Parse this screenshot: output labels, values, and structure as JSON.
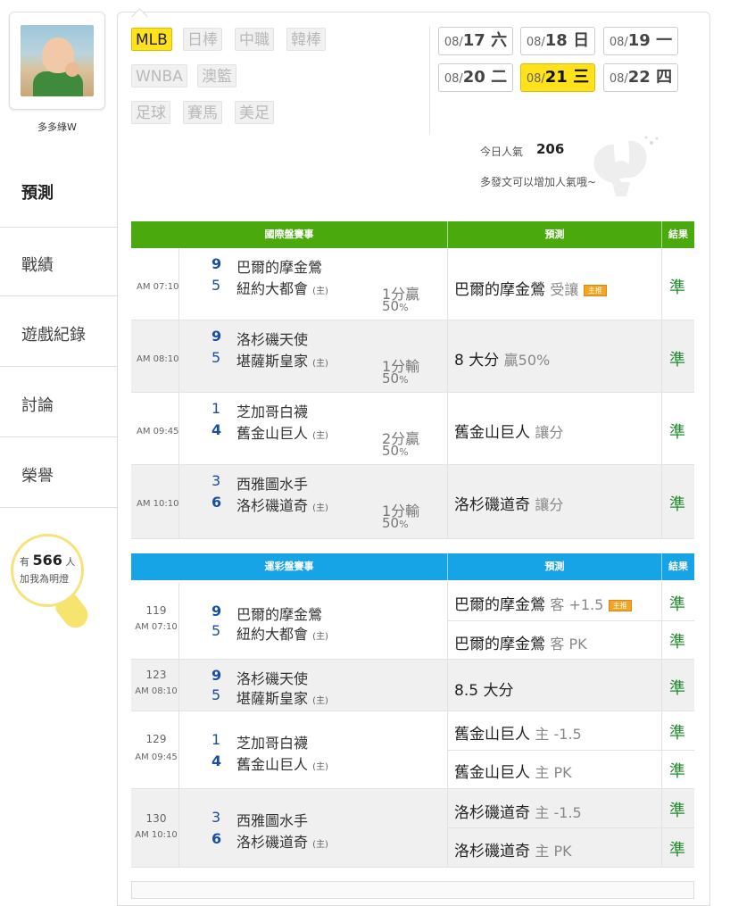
{
  "profile": {
    "username": "多多綠W"
  },
  "nav": {
    "items": [
      {
        "label": "預測",
        "active": true
      },
      {
        "label": "戰績"
      },
      {
        "label": "遊戲紀錄"
      },
      {
        "label": "討論"
      },
      {
        "label": "榮譽"
      }
    ]
  },
  "fans": {
    "prefix": "有",
    "count": "566",
    "suffix": "人",
    "caption": "加我為明燈"
  },
  "leagues": [
    {
      "label": "MLB",
      "active": true
    },
    {
      "label": "日棒"
    },
    {
      "label": "中職"
    },
    {
      "label": "韓棒"
    },
    {
      "label": "WNBA"
    },
    {
      "label": "澳籃"
    },
    {
      "label": "足球"
    },
    {
      "label": "賽馬"
    },
    {
      "label": "美足"
    }
  ],
  "dates": [
    {
      "md": "08/",
      "d": "17",
      "wd": " 六"
    },
    {
      "md": "08/",
      "d": "18",
      "wd": " 日"
    },
    {
      "md": "08/",
      "d": "19",
      "wd": " 一"
    },
    {
      "md": "08/",
      "d": "20",
      "wd": " 二"
    },
    {
      "md": "08/",
      "d": "21",
      "wd": " 三",
      "active": true
    },
    {
      "md": "08/",
      "d": "22",
      "wd": " 四"
    }
  ],
  "popularity": {
    "label": "今日人氣",
    "value": "206",
    "hint": "多發文可以增加人氣哦~"
  },
  "intl": {
    "header": {
      "game": "國際盤賽事",
      "pred": "預測",
      "result": "結果"
    },
    "color": "#4aaa0d",
    "games": [
      {
        "time": "AM 07:10",
        "s1": "9",
        "t1": "巴爾的摩金鶯",
        "s2": "5",
        "t2": "紐約大都會",
        "home": "(主)",
        "spread": "1分贏",
        "pct": "50",
        "pct_unit": "%",
        "pred": "巴爾的摩金鶯",
        "pred_sub": "受讓",
        "tag": "主推",
        "result": "準"
      },
      {
        "time": "AM 08:10",
        "s1": "9",
        "t1": "洛杉磯天使",
        "s2": "5",
        "t2": "堪薩斯皇家",
        "home": "(主)",
        "spread": "1分輸",
        "pct": "50",
        "pct_unit": "%",
        "pred": "8 大分",
        "pred_sub": "贏50%",
        "result": "準"
      },
      {
        "time": "AM 09:45",
        "s1": "1",
        "t1": "芝加哥白襪",
        "s2": "4",
        "t2": "舊金山巨人",
        "home": "(主)",
        "spread": "2分贏",
        "pct": "50",
        "pct_unit": "%",
        "pred": "舊金山巨人",
        "pred_sub": "讓分",
        "result": "準"
      },
      {
        "time": "AM 10:10",
        "s1": "3",
        "t1": "西雅圖水手",
        "s2": "6",
        "t2": "洛杉磯道奇",
        "home": "(主)",
        "spread": "1分輸",
        "pct": "50",
        "pct_unit": "%",
        "pred": "洛杉磯道奇",
        "pred_sub": "讓分",
        "result": "準"
      }
    ]
  },
  "lottery": {
    "header": {
      "game": "運彩盤賽事",
      "pred": "預測",
      "result": "結果"
    },
    "color": "#17a4e6",
    "games": [
      {
        "num": "119",
        "time": "AM 07:10",
        "s1": "9",
        "t1": "巴爾的摩金鶯",
        "s2": "5",
        "t2": "紐約大都會",
        "home": "(主)",
        "preds": [
          {
            "team": "巴爾的摩金鶯",
            "sub": "客 +1.5",
            "tag": "主推",
            "result": "準"
          },
          {
            "team": "巴爾的摩金鶯",
            "sub": "客 PK",
            "result": "準"
          }
        ]
      },
      {
        "num": "123",
        "time": "AM 08:10",
        "s1": "9",
        "t1": "洛杉磯天使",
        "s2": "5",
        "t2": "堪薩斯皇家",
        "home": "(主)",
        "preds": [
          {
            "team": "8.5 大分",
            "sub": "",
            "result": "準"
          }
        ]
      },
      {
        "num": "129",
        "time": "AM 09:45",
        "s1": "1",
        "t1": "芝加哥白襪",
        "s2": "4",
        "t2": "舊金山巨人",
        "home": "(主)",
        "preds": [
          {
            "team": "舊金山巨人",
            "sub": "主 -1.5",
            "result": "準"
          },
          {
            "team": "舊金山巨人",
            "sub": "主 PK",
            "result": "準"
          }
        ]
      },
      {
        "num": "130",
        "time": "AM 10:10",
        "s1": "3",
        "t1": "西雅圖水手",
        "s2": "6",
        "t2": "洛杉磯道奇",
        "home": "(主)",
        "preds": [
          {
            "team": "洛杉磯道奇",
            "sub": "主 -1.5",
            "result": "準"
          },
          {
            "team": "洛杉磯道奇",
            "sub": "主 PK",
            "result": "準"
          }
        ]
      }
    ]
  }
}
